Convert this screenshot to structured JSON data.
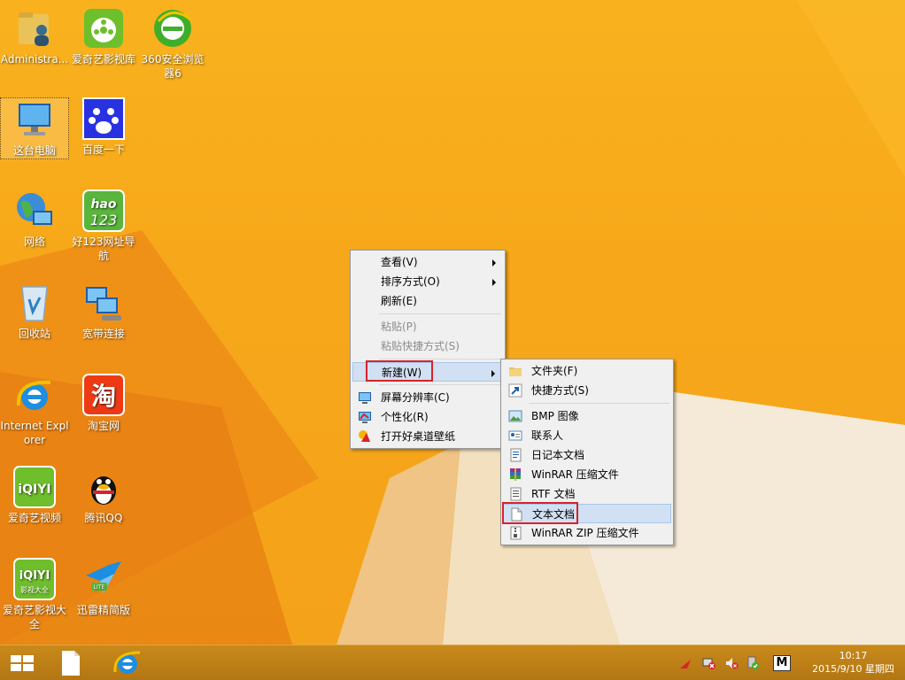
{
  "desktop": {
    "icons": [
      {
        "label": "Administra..."
      },
      {
        "label": "爱奇艺影视库"
      },
      {
        "label": "360安全浏览器6"
      },
      {
        "label": "这台电脑"
      },
      {
        "label": "百度一下"
      },
      {
        "label": "网络"
      },
      {
        "label": "好123网址导航"
      },
      {
        "label": "回收站"
      },
      {
        "label": "宽带连接"
      },
      {
        "label": "Internet Explorer"
      },
      {
        "label": "淘宝网"
      },
      {
        "label": "爱奇艺视频"
      },
      {
        "label": "腾讯QQ"
      },
      {
        "label": "爱奇艺影视大全"
      },
      {
        "label": "迅雷精简版"
      }
    ],
    "icon_text": {
      "hao": "hao",
      "num": "123",
      "iqiyi": "iQIYI",
      "iqiyi_sub": "影视大全",
      "lite": "LITE",
      "taobao": "淘"
    }
  },
  "context_menu": {
    "items": [
      {
        "label": "查看(V)"
      },
      {
        "label": "排序方式(O)"
      },
      {
        "label": "刷新(E)"
      },
      {
        "label": "粘贴(P)"
      },
      {
        "label": "粘贴快捷方式(S)"
      },
      {
        "label": "新建(W)"
      },
      {
        "label": "屏幕分辨率(C)"
      },
      {
        "label": "个性化(R)"
      },
      {
        "label": "打开好桌道壁纸"
      }
    ]
  },
  "submenu": {
    "items": [
      {
        "label": "文件夹(F)"
      },
      {
        "label": "快捷方式(S)"
      },
      {
        "label": "BMP 图像"
      },
      {
        "label": "联系人"
      },
      {
        "label": "日记本文档"
      },
      {
        "label": "WinRAR 压缩文件"
      },
      {
        "label": "RTF 文档"
      },
      {
        "label": "文本文档"
      },
      {
        "label": "WinRAR ZIP 压缩文件"
      }
    ]
  },
  "taskbar": {
    "ime_label": "M",
    "time": "10:17",
    "date": "2015/9/10 星期四"
  },
  "colors": {
    "accent_highlight": "#d1e0f2",
    "annotation_red": "#d9222a",
    "taskbar": "#b27613"
  }
}
